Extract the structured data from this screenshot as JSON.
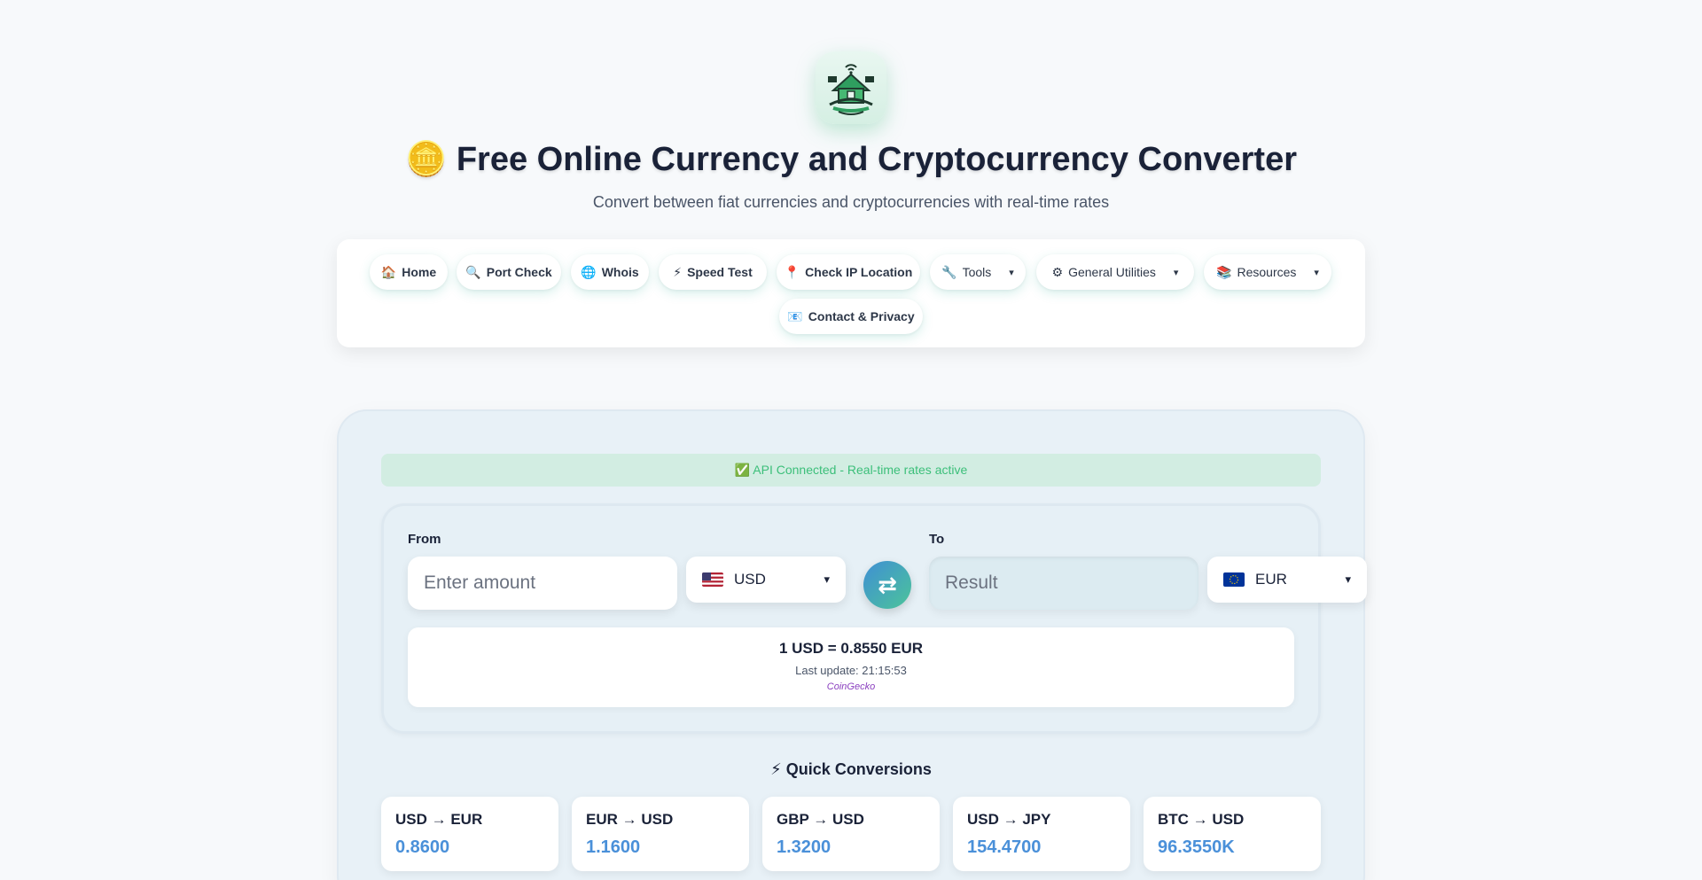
{
  "header": {
    "logo_icon": "smart-home-wifi-logo",
    "title": "🪙 Free Online Currency and Cryptocurrency Converter",
    "subtitle": "Convert between fiat currencies and cryptocurrencies with real-time rates"
  },
  "nav": {
    "items": [
      {
        "icon": "🏠",
        "label": "Home"
      },
      {
        "icon": "🔍",
        "label": "Port Check"
      },
      {
        "icon": "🌐",
        "label": "Whois"
      },
      {
        "icon": "⚡",
        "label": "Speed Test"
      },
      {
        "icon": "📍",
        "label": "Check IP Location"
      },
      {
        "icon": "🔧",
        "label": "Tools",
        "caret": "▾"
      },
      {
        "icon": "⚙",
        "label": "General Utilities",
        "caret": "▾"
      },
      {
        "icon": "📚",
        "label": "Resources",
        "caret": "▾"
      },
      {
        "icon": "📧",
        "label": "Contact & Privacy"
      }
    ]
  },
  "status": {
    "text": "✅ API Connected - Real-time rates active",
    "color": "#3cbf7a"
  },
  "converter": {
    "from_label": "From",
    "to_label": "To",
    "amount_placeholder": "Enter amount",
    "result_placeholder": "Result",
    "from_currency": "USD",
    "to_currency": "EUR",
    "caret": "▾",
    "swap_icon": "⇄",
    "rate_text": "1 USD = 0.8550 EUR",
    "last_update": "Last update: 21:15:53",
    "source": "CoinGecko"
  },
  "quick": {
    "title": "⚡ Quick Conversions",
    "items": [
      {
        "pair": "USD → EUR",
        "value": "0.8600"
      },
      {
        "pair": "EUR → USD",
        "value": "1.1600"
      },
      {
        "pair": "GBP → USD",
        "value": "1.3200"
      },
      {
        "pair": "USD → JPY",
        "value": "154.4700"
      },
      {
        "pair": "BTC → USD",
        "value": "96.3550K"
      }
    ]
  },
  "colors": {
    "accent": "#4a90d9",
    "swap_gradient_start": "#3f8fd4",
    "swap_gradient_end": "#4cc49a",
    "source_link": "#8a3fbf"
  }
}
